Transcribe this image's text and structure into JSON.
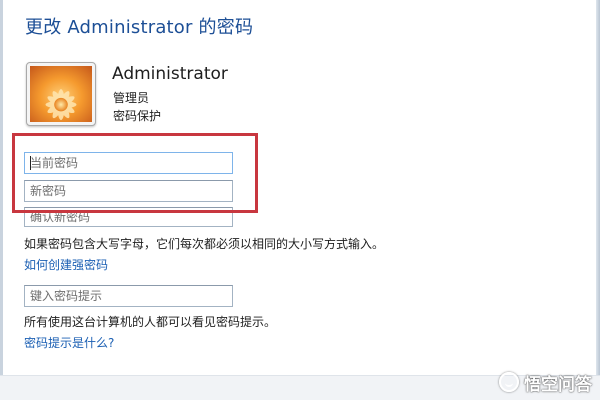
{
  "window": {
    "title": "更改 Administrator 的密码"
  },
  "user": {
    "avatar_icon": "flower-avatar-icon",
    "name": "Administrator",
    "role": "管理员",
    "protection": "密码保护"
  },
  "form": {
    "current_password_placeholder": "当前密码",
    "new_password_placeholder": "新密码",
    "confirm_password_placeholder": "确认新密码",
    "case_note": "如果密码包含大写字母，它们每次都必须以相同的大小写方式输入。",
    "create_strong_link": "如何创建强密码",
    "hint_placeholder": "键入密码提示",
    "hint_visibility_note": "所有使用这台计算机的人都可以看见密码提示。",
    "what_is_hint_link": "密码提示是什么?"
  },
  "annotation": {
    "highlight_color": "#c8373f"
  },
  "watermark": {
    "text": "悟空问答",
    "icon": "wukong-logo-icon"
  },
  "colors": {
    "title": "#1d4f96",
    "link": "#1b5fb3"
  }
}
